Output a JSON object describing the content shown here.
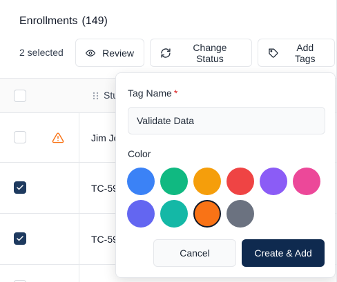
{
  "header": {
    "title": "Enrollments",
    "count": "(149)"
  },
  "toolbar": {
    "selected_text": "2 selected",
    "review_label": "Review",
    "change_status_label": "Change Status",
    "add_tags_label": "Add Tags"
  },
  "table": {
    "column_header": "Stu",
    "rows": [
      {
        "text": "Jim Jo",
        "checked": false,
        "warning": true
      },
      {
        "text": "TC-59",
        "checked": true,
        "warning": false
      },
      {
        "text": "TC-59",
        "checked": true,
        "warning": false
      }
    ]
  },
  "popover": {
    "tag_name_label": "Tag Name",
    "required_mark": "*",
    "tag_name_value": "Validate Data",
    "color_label": "Color",
    "colors": [
      "#3b82f6",
      "#10b981",
      "#f59e0b",
      "#ef4444",
      "#8b5cf6",
      "#ec4899",
      "#6366f1",
      "#14b8a6",
      "#f97316",
      "#6b7280"
    ],
    "selected_color_index": 8,
    "cancel_label": "Cancel",
    "create_label": "Create & Add"
  },
  "theme": {
    "primary": "#0f2a4f",
    "warning": "#f97316",
    "required": "#dc2626"
  }
}
